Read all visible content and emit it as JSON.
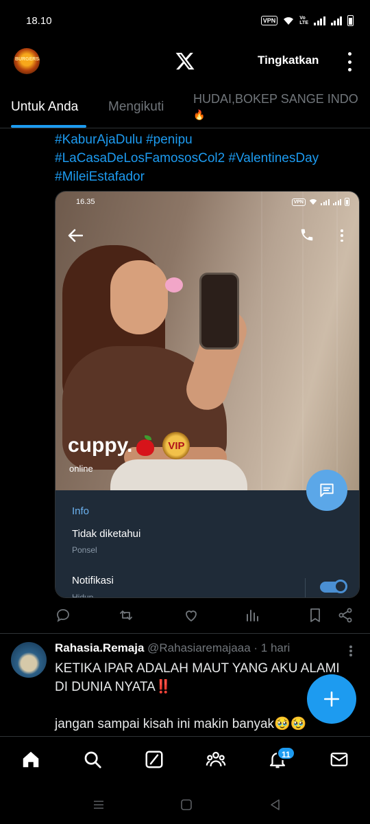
{
  "status_bar": {
    "time": "18.10",
    "vpn": "VPN",
    "lte": "Vo LTE"
  },
  "header": {
    "avatar_text": "BURGERSPORT",
    "logo": "x-logo",
    "upgrade_label": "Tingkatkan",
    "more_icon": "kebab-icon"
  },
  "tabs": [
    {
      "label": "Untuk Anda",
      "active": true
    },
    {
      "label": "Mengikuti",
      "active": false
    },
    {
      "label": "HUDAI,BOKEP SANGE INDO",
      "active": false
    }
  ],
  "tweet1": {
    "hashtags": [
      "#KaburAjaDulu #penipu",
      "#LaCasaDeLosFamososCol2 #ValentinesDay",
      "#MileiEstafador"
    ],
    "screenshot": {
      "time": "16.35",
      "vpn": "VPN",
      "profile_name": "cuppy.",
      "badge": "VIP",
      "status": "online",
      "info_title": "Info",
      "phone_value": "Tidak diketahui",
      "phone_label": "Ponsel",
      "notif_value": "Notifikasi",
      "notif_label": "Hidup"
    }
  },
  "tweet2": {
    "name": "Rahasia.Remaja",
    "handle": "@Rahasiaremajaaa",
    "time": "· 1 hari",
    "line1": "KETIKA IPAR ADALAH MAUT YANG AKU ALAMI",
    "line2": "DI DUNIA NYATA‼️",
    "line3": "jangan sampai kisah ini makin banyak🥹🥹"
  },
  "bottom_nav": {
    "notifications_badge": "11"
  },
  "colors": {
    "accent": "#1d9bf0",
    "background": "#000000",
    "text": "#e7e9ea",
    "muted": "#71767b"
  }
}
